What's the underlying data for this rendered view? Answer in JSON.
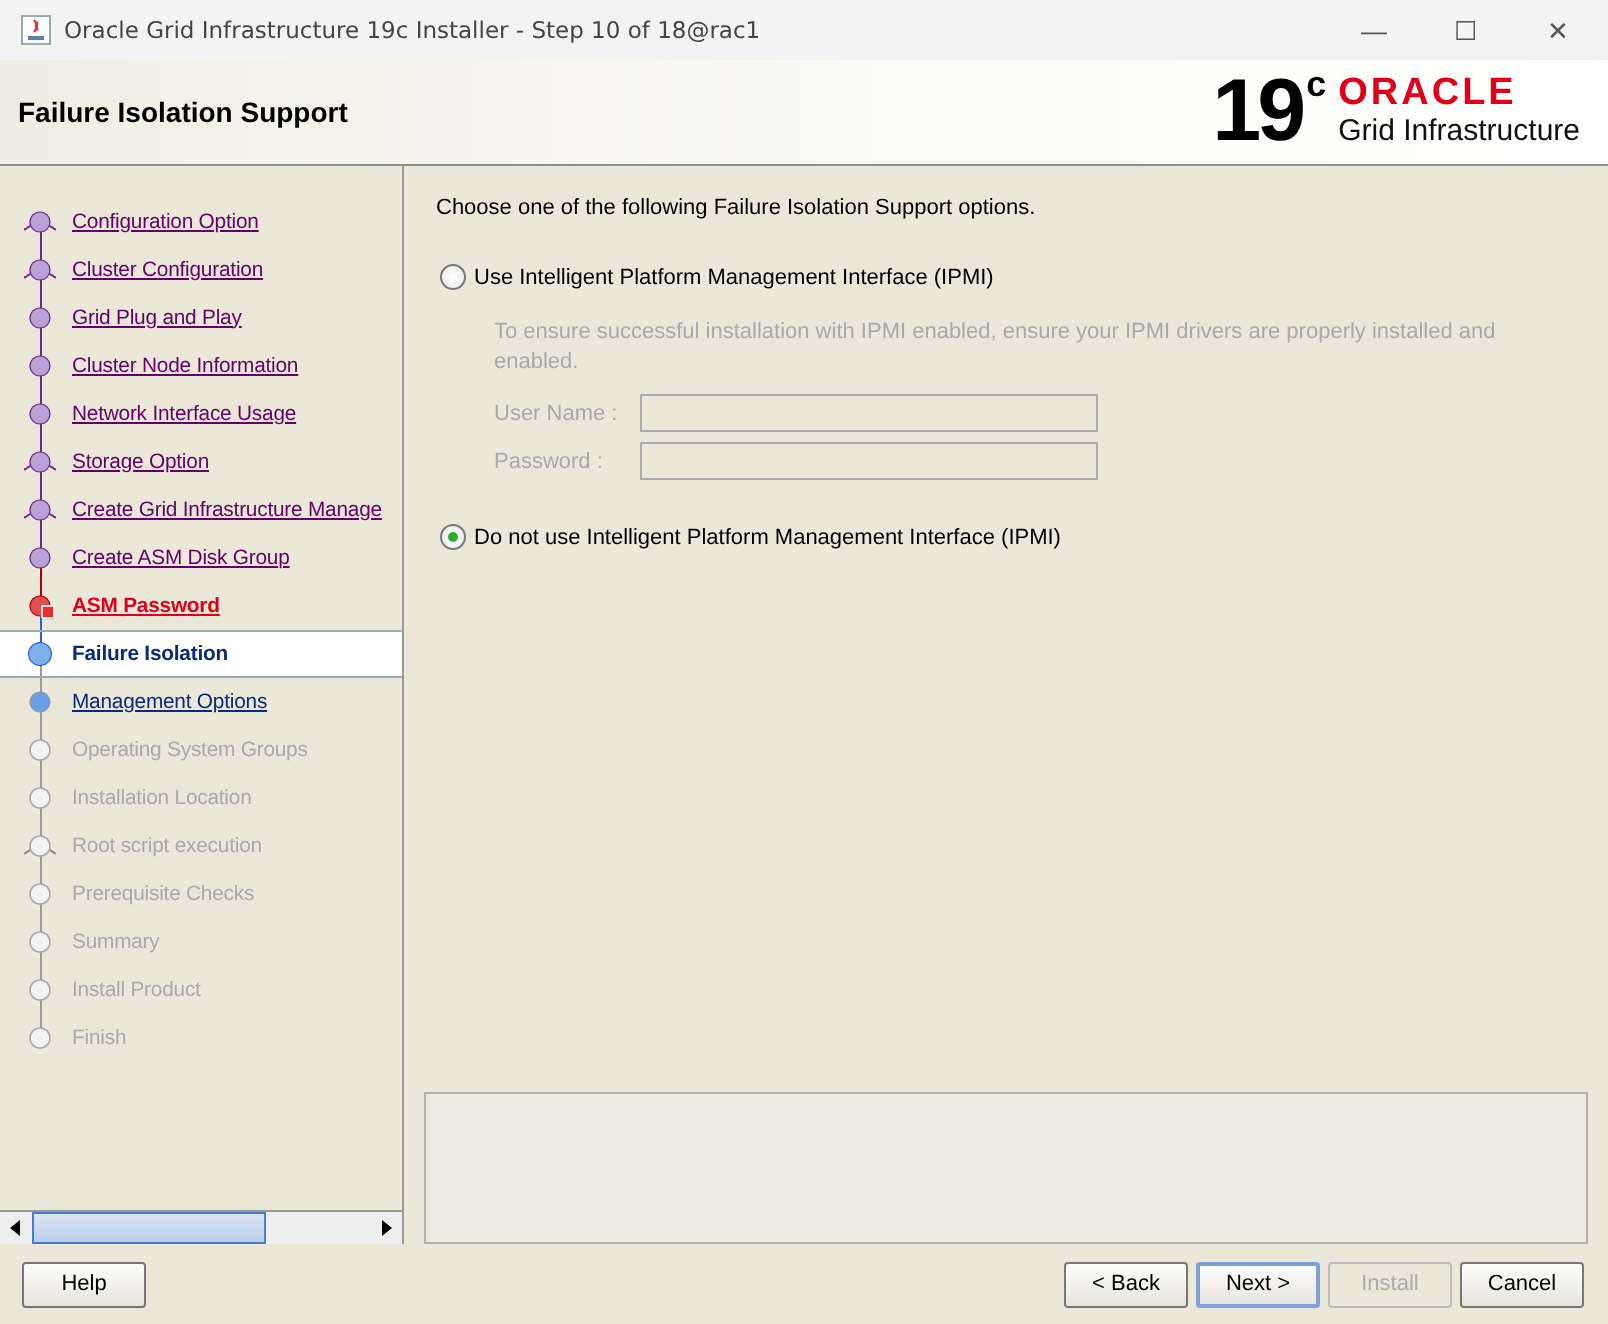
{
  "window": {
    "title": "Oracle Grid Infrastructure 19c Installer - Step 10 of 18@rac1",
    "controls": [
      "—",
      "☐",
      "✕"
    ]
  },
  "header": {
    "title": "Failure Isolation Support",
    "logo_version": "19",
    "logo_suffix": "c",
    "logo_brand": "ORACLE",
    "logo_product": "Grid Infrastructure"
  },
  "steps": [
    {
      "label": "Configuration Option",
      "kind": "visited",
      "branch": true,
      "selected": false
    },
    {
      "label": "Cluster Configuration",
      "kind": "visited",
      "branch": true,
      "selected": false
    },
    {
      "label": "Grid Plug and Play",
      "kind": "visited",
      "branch": false,
      "selected": false
    },
    {
      "label": "Cluster Node Information",
      "kind": "visited",
      "branch": false,
      "selected": false
    },
    {
      "label": "Network Interface Usage",
      "kind": "visited",
      "branch": false,
      "selected": false
    },
    {
      "label": "Storage Option",
      "kind": "visited",
      "branch": true,
      "selected": false
    },
    {
      "label": "Create Grid Infrastructure Manage",
      "kind": "visited",
      "branch": true,
      "selected": false
    },
    {
      "label": "Create ASM Disk Group",
      "kind": "visited",
      "branch": false,
      "selected": false
    },
    {
      "label": "ASM Password",
      "kind": "error",
      "branch": false,
      "selected": false
    },
    {
      "label": "Failure Isolation",
      "kind": "current",
      "branch": false,
      "selected": true
    },
    {
      "label": "Management Options",
      "kind": "next",
      "branch": false,
      "selected": false
    },
    {
      "label": "Operating System Groups",
      "kind": "pending",
      "branch": false,
      "selected": false
    },
    {
      "label": "Installation Location",
      "kind": "pending",
      "branch": false,
      "selected": false
    },
    {
      "label": "Root script execution",
      "kind": "pending",
      "branch": true,
      "selected": false
    },
    {
      "label": "Prerequisite Checks",
      "kind": "pending",
      "branch": false,
      "selected": false
    },
    {
      "label": "Summary",
      "kind": "pending",
      "branch": false,
      "selected": false
    },
    {
      "label": "Install Product",
      "kind": "pending",
      "branch": false,
      "selected": false
    },
    {
      "label": "Finish",
      "kind": "pending",
      "branch": false,
      "selected": false
    }
  ],
  "content": {
    "instruction": "Choose one of the following Failure Isolation Support options.",
    "options": [
      {
        "label": "Use Intelligent Platform Management Interface (IPMI)",
        "selected": false,
        "note": "To ensure successful installation with IPMI enabled, ensure your IPMI drivers are properly installed and enabled.",
        "fields": [
          {
            "label": "User Name :",
            "disabled": true
          },
          {
            "label": "Password :",
            "disabled": true
          }
        ]
      },
      {
        "label": "Do not use Intelligent Platform Management Interface (IPMI)",
        "selected": true
      }
    ]
  },
  "buttons": [
    {
      "label": "Help",
      "kind": "left",
      "disabled": false,
      "focused": false
    },
    {
      "label": "< Back",
      "kind": "right",
      "disabled": false,
      "focused": false
    },
    {
      "label": "Next >",
      "kind": "right",
      "disabled": false,
      "focused": true
    },
    {
      "label": "Install",
      "kind": "right",
      "disabled": true,
      "focused": false
    },
    {
      "label": "Cancel",
      "kind": "right",
      "disabled": false,
      "focused": false
    }
  ]
}
